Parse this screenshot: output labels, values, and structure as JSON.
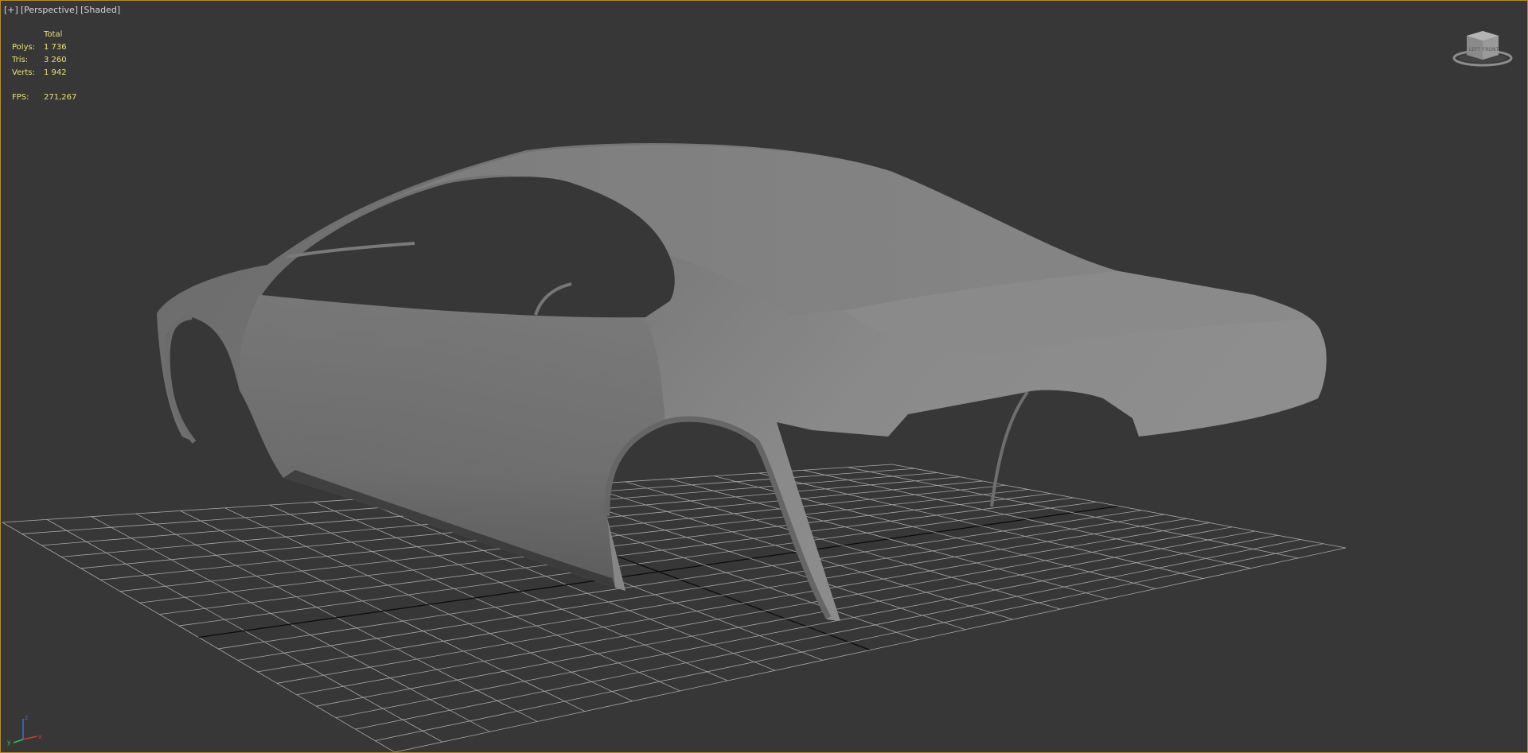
{
  "viewport": {
    "label_plus": "[+]",
    "label_view": "[Perspective]",
    "label_shading": "[Shaded]"
  },
  "stats": {
    "header": "Total",
    "polys_label": "Polys:",
    "polys_value": "1 736",
    "tris_label": "Tris:",
    "tris_value": "3 260",
    "verts_label": "Verts:",
    "verts_value": "1 942",
    "fps_label": "FPS:",
    "fps_value": "271,267"
  },
  "viewcube": {
    "left_face": "LEFT",
    "front_face": "FRONT"
  },
  "axis": {
    "x": "x",
    "y": "y",
    "z": "z"
  },
  "colors": {
    "background": "#373737",
    "grid": "#a6a6a6",
    "grid_axis": "#0a0a0a",
    "stats_text": "#e8e07a",
    "border": "#b58c2a",
    "axis_x": "#d23a2a",
    "axis_y": "#3fbf3f",
    "axis_z": "#3d6bd6"
  }
}
